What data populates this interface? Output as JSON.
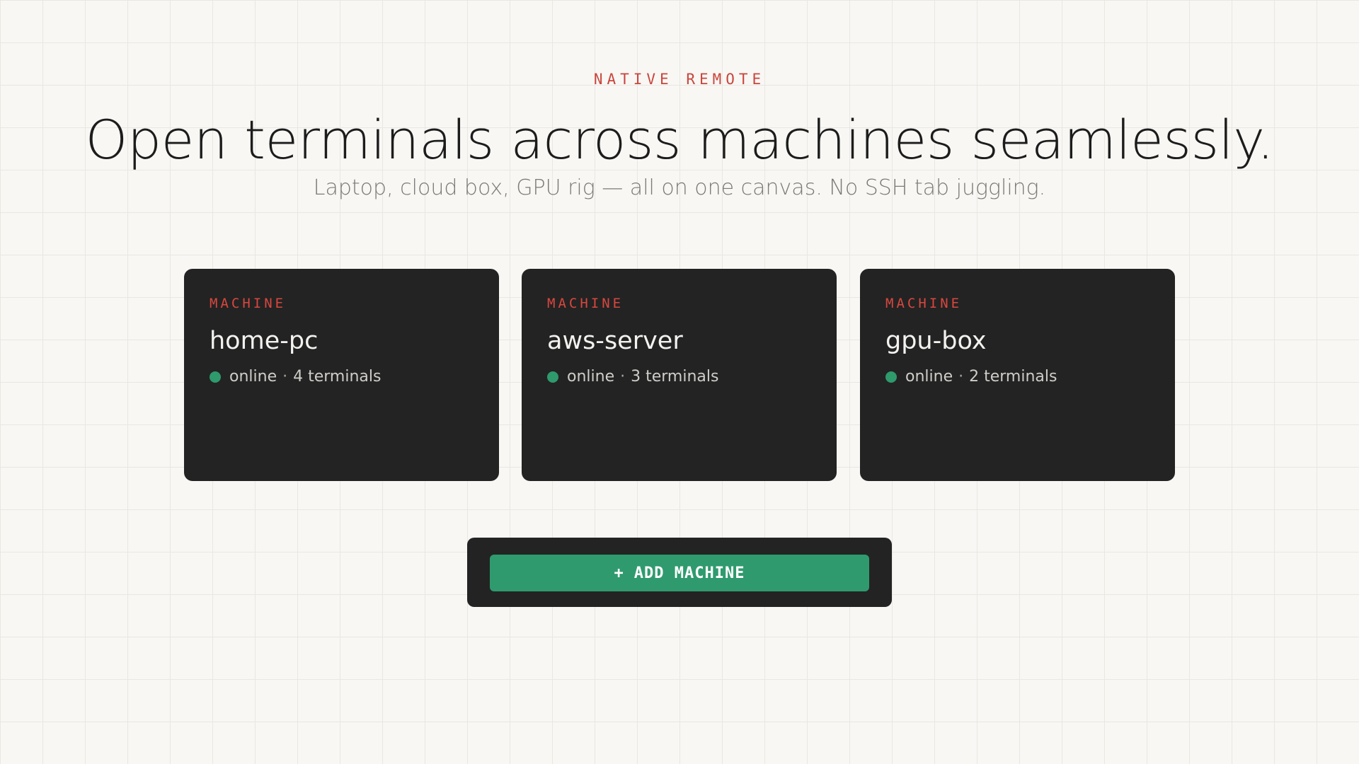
{
  "hero": {
    "eyebrow": "NATIVE REMOTE",
    "headline": "Open terminals across machines seamlessly.",
    "subtitle": "Laptop, cloud box, GPU rig — all on one canvas. No SSH tab juggling."
  },
  "machines": [
    {
      "label": "MACHINE",
      "name": "home-pc",
      "status": "online",
      "separator": "·",
      "terminals": "4 terminals"
    },
    {
      "label": "MACHINE",
      "name": "aws-server",
      "status": "online",
      "separator": "·",
      "terminals": "3 terminals"
    },
    {
      "label": "MACHINE",
      "name": "gpu-box",
      "status": "online",
      "separator": "·",
      "terminals": "2 terminals"
    }
  ],
  "action": {
    "plus": "+",
    "label": "ADD MACHINE"
  },
  "colors": {
    "accent_red": "#d9473f",
    "online_green": "#2f9a6b",
    "card_bg": "#232323",
    "page_bg": "#f8f7f4"
  }
}
